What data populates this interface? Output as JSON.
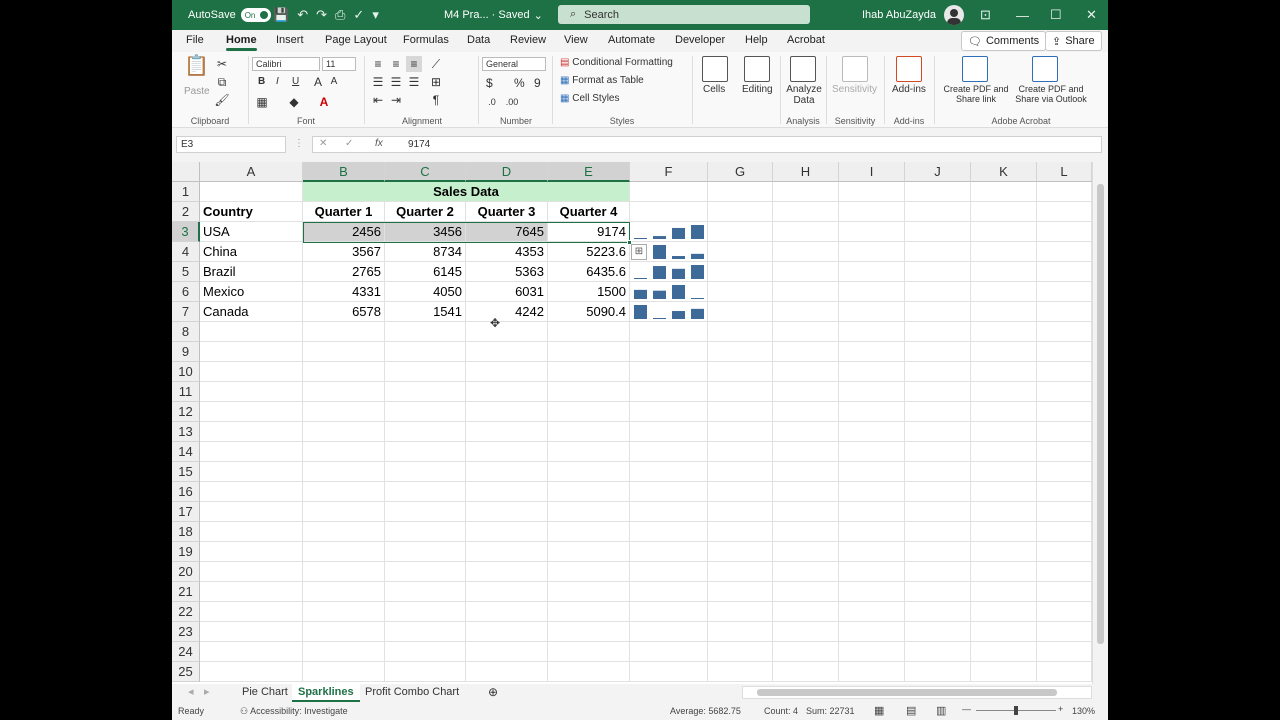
{
  "titlebar": {
    "autosave": "AutoSave",
    "toggle": "On",
    "file": "M4 Pra... · Saved",
    "search_placeholder": "Search",
    "user": "Ihab AbuZayda"
  },
  "menu": {
    "tabs": [
      "File",
      "Home",
      "Insert",
      "Page Layout",
      "Formulas",
      "Data",
      "Review",
      "View",
      "Automate",
      "Developer",
      "Help",
      "Acrobat"
    ],
    "comments": "Comments",
    "share": "Share"
  },
  "ribbon": {
    "clipboard": {
      "paste": "Paste",
      "label": "Clipboard"
    },
    "font": {
      "name": "Calibri",
      "size": "11",
      "label": "Font",
      "b": "B",
      "i": "I",
      "u": "U"
    },
    "alignment": {
      "label": "Alignment"
    },
    "number": {
      "format": "General",
      "label": "Number",
      "currency": "$",
      "percent": "%",
      "comma": "9"
    },
    "styles": {
      "cond": "Conditional Formatting",
      "table": "Format as Table",
      "cell": "Cell Styles",
      "label": "Styles"
    },
    "cells": "Cells",
    "editing": "Editing",
    "analysis": {
      "btn": "Analyze Data",
      "label": "Analysis"
    },
    "sensitivity": {
      "btn": "Sensitivity",
      "label": "Sensitivity"
    },
    "addins": {
      "btn": "Add-ins",
      "label": "Add-ins"
    },
    "acrobat": {
      "pdf1": "Create PDF and Share link",
      "pdf2": "Create PDF and Share via Outlook",
      "label": "Adobe Acrobat"
    }
  },
  "formula": {
    "namebox": "E3",
    "fx": "fx",
    "value": "9174"
  },
  "columns": [
    "A",
    "B",
    "C",
    "D",
    "E",
    "F",
    "G",
    "H",
    "I",
    "J",
    "K",
    "L"
  ],
  "sheet": {
    "title": "Sales Data",
    "headers": [
      "Country",
      "Quarter 1",
      "Quarter 2",
      "Quarter 3",
      "Quarter 4"
    ],
    "rows": [
      [
        "USA",
        "2456",
        "3456",
        "7645",
        "9174"
      ],
      [
        "China",
        "3567",
        "8734",
        "4353",
        "5223.6"
      ],
      [
        "Brazil",
        "2765",
        "6145",
        "5363",
        "6435.6"
      ],
      [
        "Mexico",
        "4331",
        "4050",
        "6031",
        "1500"
      ],
      [
        "Canada",
        "6578",
        "1541",
        "4242",
        "5090.4"
      ]
    ],
    "sparklines": [
      [
        2456,
        3456,
        7645,
        9174
      ],
      [
        3567,
        8734,
        4353,
        5223.6
      ],
      [
        2765,
        6145,
        5363,
        6435.6
      ],
      [
        4331,
        4050,
        6031,
        1500
      ],
      [
        6578,
        1541,
        4242,
        5090.4
      ]
    ],
    "spark_color": "#3d6a99"
  },
  "tabs": [
    "Pie Chart",
    "Sparklines",
    "Profit Combo Chart"
  ],
  "status": {
    "ready": "Ready",
    "accessibility": "Accessibility: Investigate",
    "average": "Average: 5682.75",
    "count": "Count: 4",
    "sum": "Sum: 22731",
    "zoom": "130%"
  }
}
